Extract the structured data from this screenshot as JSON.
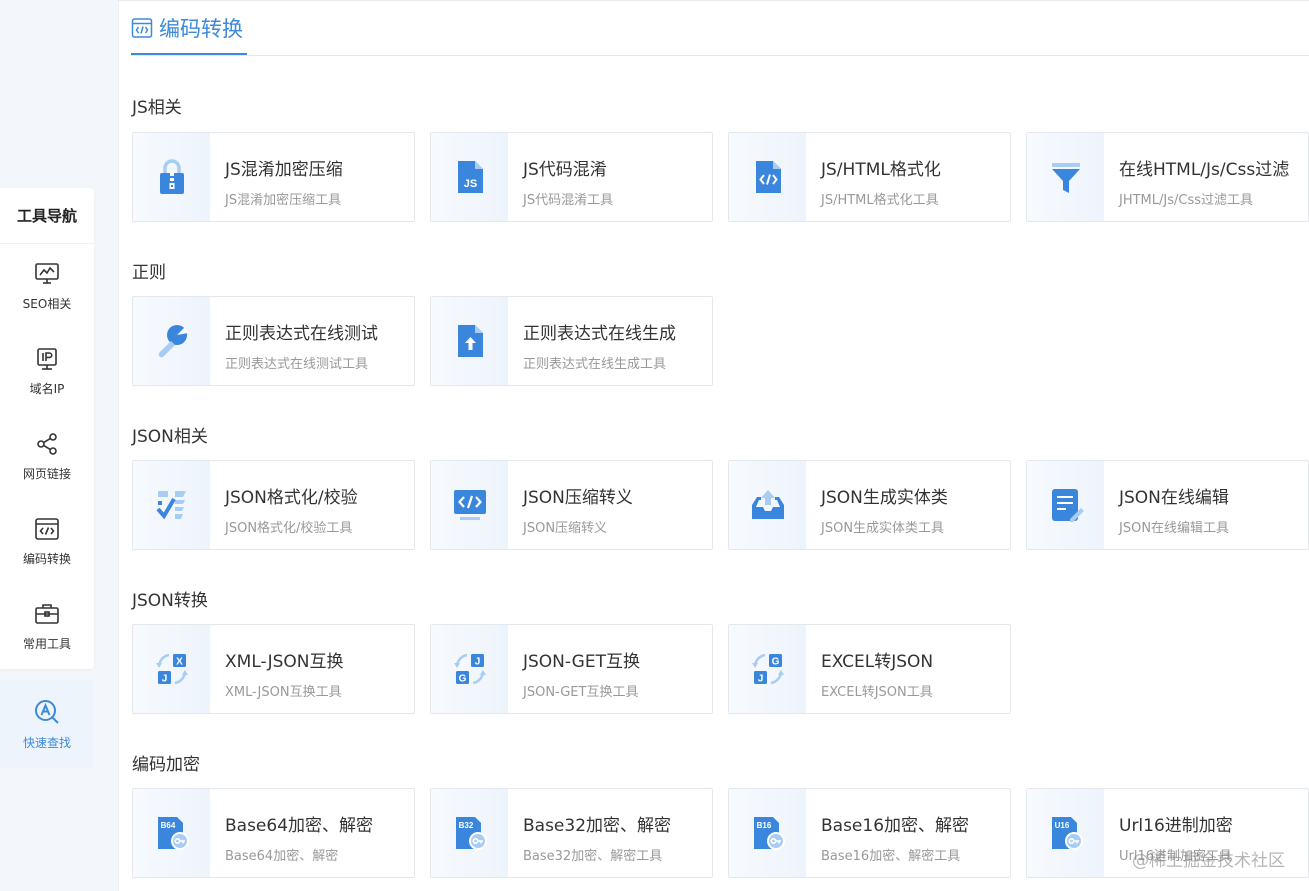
{
  "nav": {
    "title": "工具导航",
    "items": [
      {
        "label": "SEO相关",
        "icon": "monitor-chart-icon"
      },
      {
        "label": "域名IP",
        "icon": "ip-icon"
      },
      {
        "label": "网页链接",
        "icon": "share-icon"
      },
      {
        "label": "编码转换",
        "icon": "code-window-icon"
      },
      {
        "label": "常用工具",
        "icon": "toolbox-icon"
      }
    ],
    "quick": {
      "label": "快速查找",
      "icon": "search-a-icon"
    }
  },
  "header": {
    "title": "编码转换"
  },
  "sections": [
    {
      "title": "JS相关",
      "cards": [
        {
          "title": "JS混淆加密压缩",
          "desc": "JS混淆加密压缩工具",
          "icon": "zip-lock-icon"
        },
        {
          "title": "JS代码混淆",
          "desc": "JS代码混淆工具",
          "icon": "js-file-icon"
        },
        {
          "title": "JS/HTML格式化",
          "desc": "JS/HTML格式化工具",
          "icon": "code-file-icon"
        },
        {
          "title": "在线HTML/Js/Css过滤",
          "desc": "JHTML/Js/Css过滤工具",
          "icon": "filter-icon"
        }
      ]
    },
    {
      "title": "正则",
      "cards": [
        {
          "title": "正则表达式在线测试",
          "desc": "正则表达式在线测试工具",
          "icon": "wrench-icon"
        },
        {
          "title": "正则表达式在线生成",
          "desc": "正则表达式在线生成工具",
          "icon": "upload-file-icon"
        }
      ]
    },
    {
      "title": "JSON相关",
      "cards": [
        {
          "title": "JSON格式化/校验",
          "desc": "JSON格式化/校验工具",
          "icon": "check-list-icon"
        },
        {
          "title": "JSON压缩转义",
          "desc": "JSON压缩转义",
          "icon": "code-monitor-icon"
        },
        {
          "title": "JSON生成实体类",
          "desc": "JSON生成实体类工具",
          "icon": "tray-upload-icon"
        },
        {
          "title": "JSON在线编辑",
          "desc": "JSON在线编辑工具",
          "icon": "edit-doc-icon"
        }
      ]
    },
    {
      "title": "JSON转换",
      "cards": [
        {
          "title": "XML-JSON互换",
          "desc": "XML-JSON互换工具",
          "icon": "swap-xj-icon",
          "a": "X",
          "b": "J"
        },
        {
          "title": "JSON-GET互换",
          "desc": "JSON-GET互换工具",
          "icon": "swap-jg-icon",
          "a": "J",
          "b": "G"
        },
        {
          "title": "EXCEL转JSON",
          "desc": "EXCEL转JSON工具",
          "icon": "swap-gj-icon",
          "a": "G",
          "b": "J"
        }
      ]
    },
    {
      "title": "编码加密",
      "cards": [
        {
          "title": "Base64加密、解密",
          "desc": "Base64加密、解密",
          "icon": "b64-key-icon",
          "tag": "B64"
        },
        {
          "title": "Base32加密、解密",
          "desc": "Base32加密、解密工具",
          "icon": "b32-key-icon",
          "tag": "B32"
        },
        {
          "title": "Base16加密、解密",
          "desc": "Base16加密、解密工具",
          "icon": "b16-key-icon",
          "tag": "B16"
        },
        {
          "title": "Url16进制加密",
          "desc": "Url16进制加密工具",
          "icon": "u16-key-icon",
          "tag": "U16"
        }
      ]
    }
  ],
  "watermark": "@稀土掘金技术社区",
  "colors": {
    "accent": "#3c8ad9",
    "icon_blue": "#3a86dc",
    "icon_light": "#a9ccf2"
  }
}
